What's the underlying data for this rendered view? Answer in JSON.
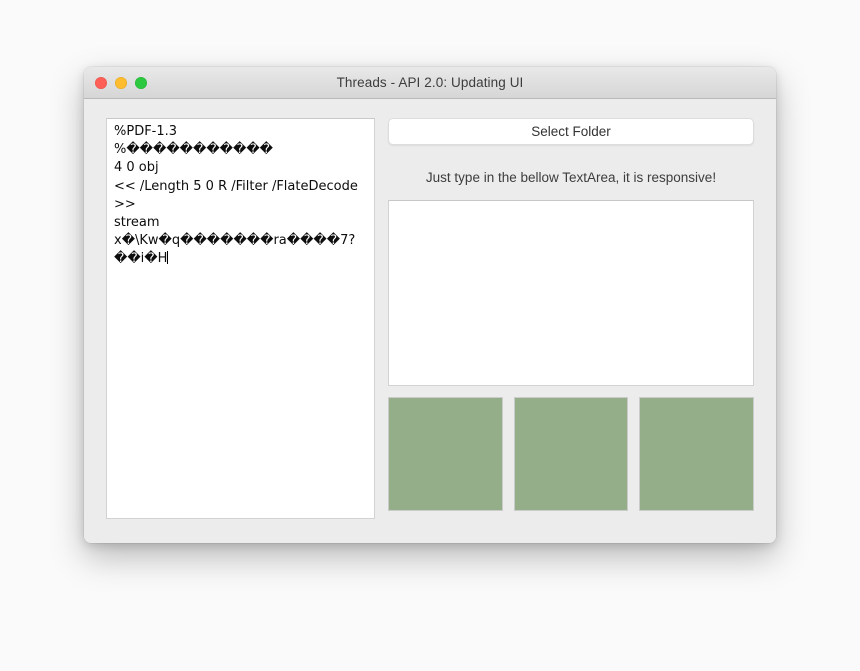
{
  "window": {
    "title": "Threads - API 2.0: Updating UI",
    "traffic_lights": [
      {
        "name": "close",
        "color": "#ff5f56"
      },
      {
        "name": "minimize",
        "color": "#febc2e"
      },
      {
        "name": "maximize",
        "color": "#2bc840"
      }
    ]
  },
  "left_pane": {
    "textarea_value": "%PDF-1.3\n%�����������\n4 0 obj\n<< /Length 5 0 R /Filter /FlateDecode >>\nstream\nx�\\Kw�q�������ra����7?��i�H",
    "has_caret": true
  },
  "right_pane": {
    "select_folder_label": "Select Folder",
    "responsive_label": "Just type in the bellow TextArea, it is responsive!",
    "responsive_textarea_value": "",
    "responsive_textarea_placeholder": "",
    "swatches": [
      {
        "label": "swatch-1",
        "color": "#94ae89"
      },
      {
        "label": "swatch-2",
        "color": "#94ae89"
      },
      {
        "label": "swatch-3",
        "color": "#94ae89"
      }
    ]
  },
  "colors": {
    "page_background": "#fafafa",
    "window_body": "#ececec",
    "titlebar_top": "#e9e9e9",
    "titlebar_bottom": "#d6d6d6",
    "title_text": "#3d3d3d",
    "field_background": "#ffffff",
    "field_border": "#d2d2d2",
    "swatch_green": "#94ae89"
  }
}
